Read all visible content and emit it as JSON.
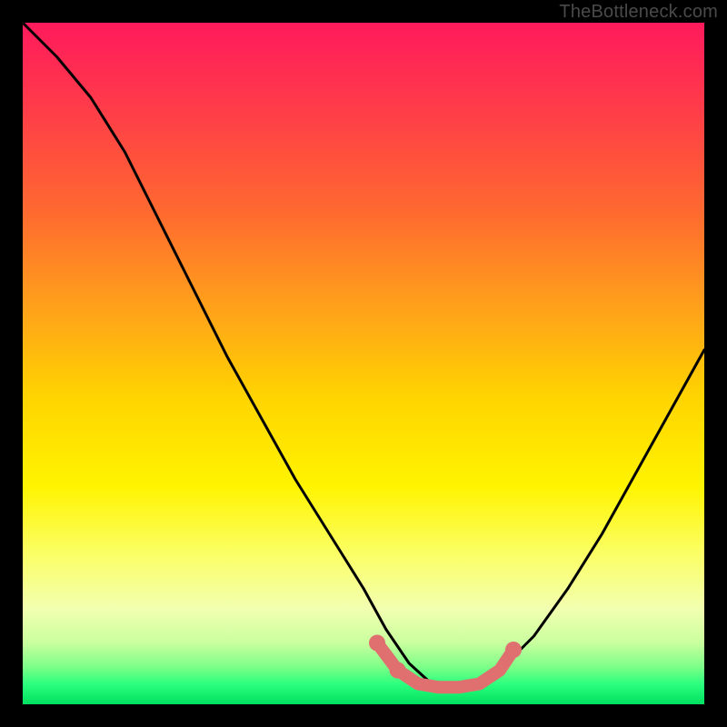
{
  "watermark": "TheBottleneck.com",
  "chart_data": {
    "type": "line",
    "title": "",
    "xlabel": "",
    "ylabel": "",
    "xlim": [
      0,
      100
    ],
    "ylim": [
      0,
      100
    ],
    "series": [
      {
        "name": "curve-black",
        "color": "#000000",
        "x": [
          0,
          5,
          10,
          15,
          20,
          25,
          30,
          35,
          40,
          45,
          50,
          53.3,
          56.7,
          60,
          63.3,
          66.7,
          70,
          75,
          80,
          85,
          90,
          95,
          100
        ],
        "values": [
          100,
          95,
          89,
          81,
          71,
          61,
          51,
          42,
          33,
          25,
          17,
          11,
          6,
          3,
          2.5,
          3,
          5,
          10,
          17,
          25,
          34,
          43,
          52
        ]
      },
      {
        "name": "flat-region-red",
        "color": "#e07070",
        "x": [
          52,
          55,
          58,
          61,
          64,
          67,
          70,
          72
        ],
        "values": [
          9,
          5,
          3,
          2.5,
          2.5,
          3,
          5,
          8
        ]
      }
    ],
    "markers": [
      {
        "x": 52,
        "y": 9,
        "color": "#e07070"
      },
      {
        "x": 55,
        "y": 5,
        "color": "#e07070"
      },
      {
        "x": 72,
        "y": 8,
        "color": "#e07070"
      }
    ]
  }
}
